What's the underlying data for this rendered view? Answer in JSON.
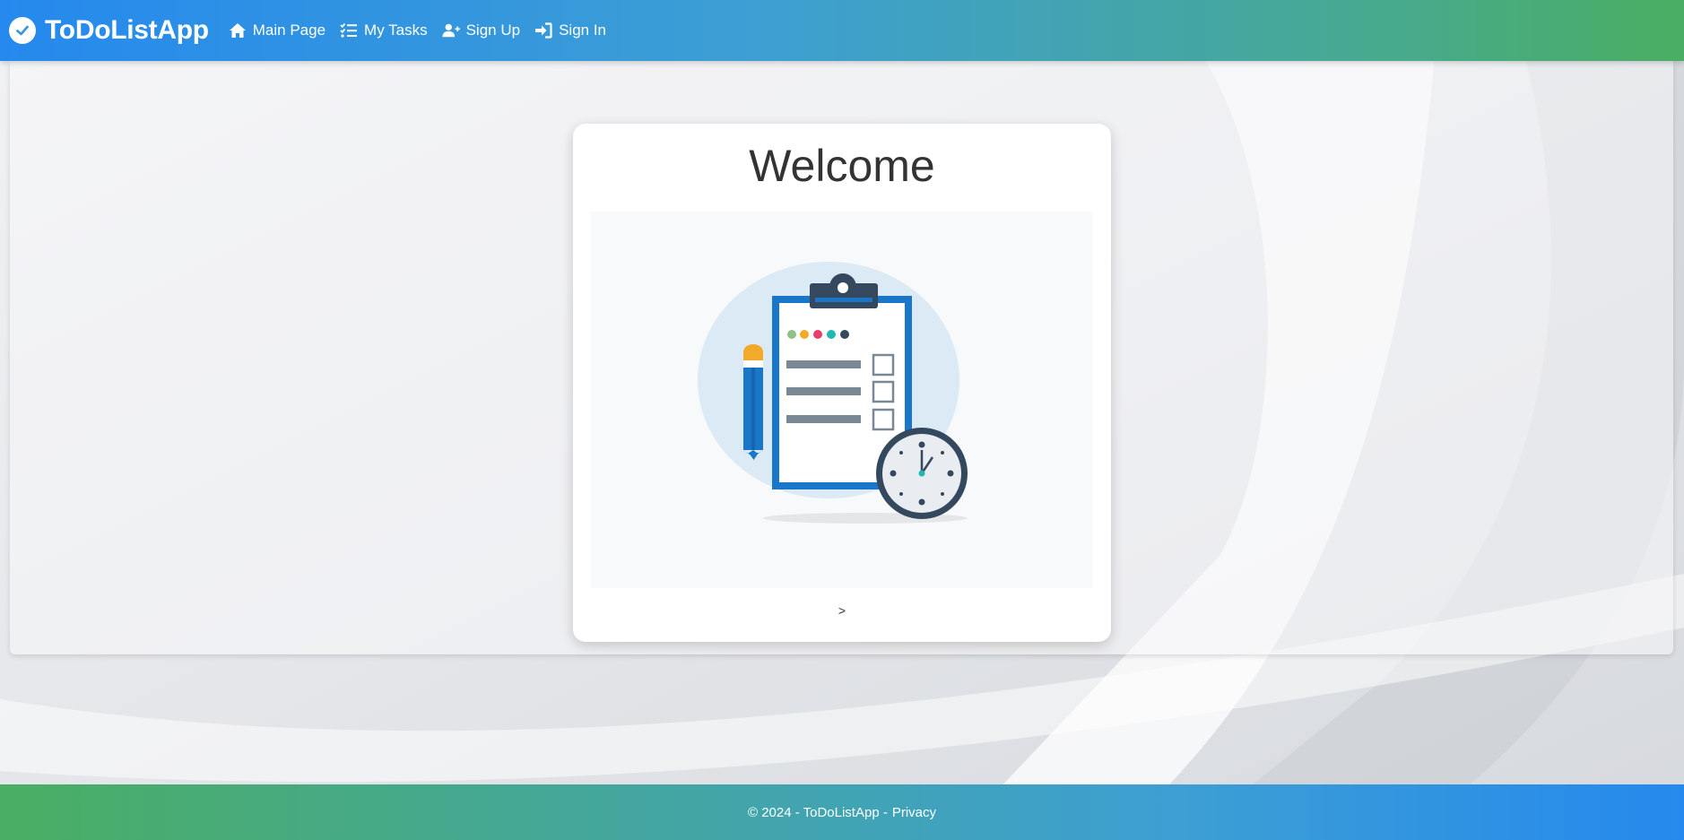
{
  "header": {
    "brand": "ToDoListApp",
    "nav": [
      {
        "label": "Main Page",
        "icon": "home-icon"
      },
      {
        "label": "My Tasks",
        "icon": "task-list-icon"
      },
      {
        "label": "Sign Up",
        "icon": "user-plus-icon"
      },
      {
        "label": "Sign In",
        "icon": "sign-in-icon"
      }
    ]
  },
  "main": {
    "title": "Welcome",
    "caption": ">"
  },
  "footer": {
    "copyright": "© 2024 - ToDoListApp -",
    "privacy_label": "Privacy"
  },
  "colors": {
    "header_gradient": [
      "#2589ee",
      "#4aae63"
    ],
    "footer_gradient": [
      "#4aae63",
      "#2589ee"
    ],
    "illustration_blue": "#1976c9",
    "illustration_navy": "#34495e"
  }
}
